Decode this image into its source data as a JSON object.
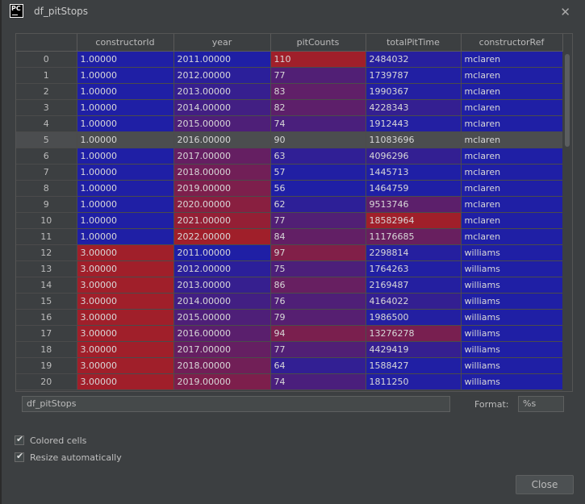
{
  "window": {
    "title": "df_pitStops"
  },
  "table": {
    "columns": [
      "constructorId",
      "year",
      "pitCounts",
      "totalPitTime",
      "constructorRef"
    ],
    "selected_row": "5",
    "rows": [
      {
        "index": "0",
        "constructorId": "1.00000",
        "year": "2011.00000",
        "pitCounts": "110",
        "totalPitTime": "2484032",
        "constructorRef": "mclaren"
      },
      {
        "index": "1",
        "constructorId": "1.00000",
        "year": "2012.00000",
        "pitCounts": "77",
        "totalPitTime": "1739787",
        "constructorRef": "mclaren"
      },
      {
        "index": "2",
        "constructorId": "1.00000",
        "year": "2013.00000",
        "pitCounts": "83",
        "totalPitTime": "1990367",
        "constructorRef": "mclaren"
      },
      {
        "index": "3",
        "constructorId": "1.00000",
        "year": "2014.00000",
        "pitCounts": "82",
        "totalPitTime": "4228343",
        "constructorRef": "mclaren"
      },
      {
        "index": "4",
        "constructorId": "1.00000",
        "year": "2015.00000",
        "pitCounts": "74",
        "totalPitTime": "1912443",
        "constructorRef": "mclaren"
      },
      {
        "index": "5",
        "constructorId": "1.00000",
        "year": "2016.00000",
        "pitCounts": "90",
        "totalPitTime": "11083696",
        "constructorRef": "mclaren"
      },
      {
        "index": "6",
        "constructorId": "1.00000",
        "year": "2017.00000",
        "pitCounts": "63",
        "totalPitTime": "4096296",
        "constructorRef": "mclaren"
      },
      {
        "index": "7",
        "constructorId": "1.00000",
        "year": "2018.00000",
        "pitCounts": "57",
        "totalPitTime": "1445713",
        "constructorRef": "mclaren"
      },
      {
        "index": "8",
        "constructorId": "1.00000",
        "year": "2019.00000",
        "pitCounts": "56",
        "totalPitTime": "1464759",
        "constructorRef": "mclaren"
      },
      {
        "index": "9",
        "constructorId": "1.00000",
        "year": "2020.00000",
        "pitCounts": "62",
        "totalPitTime": "9513746",
        "constructorRef": "mclaren"
      },
      {
        "index": "10",
        "constructorId": "1.00000",
        "year": "2021.00000",
        "pitCounts": "77",
        "totalPitTime": "18582964",
        "constructorRef": "mclaren"
      },
      {
        "index": "11",
        "constructorId": "1.00000",
        "year": "2022.00000",
        "pitCounts": "84",
        "totalPitTime": "11176685",
        "constructorRef": "mclaren"
      },
      {
        "index": "12",
        "constructorId": "3.00000",
        "year": "2011.00000",
        "pitCounts": "97",
        "totalPitTime": "2298814",
        "constructorRef": "williams"
      },
      {
        "index": "13",
        "constructorId": "3.00000",
        "year": "2012.00000",
        "pitCounts": "75",
        "totalPitTime": "1764263",
        "constructorRef": "williams"
      },
      {
        "index": "14",
        "constructorId": "3.00000",
        "year": "2013.00000",
        "pitCounts": "86",
        "totalPitTime": "2169487",
        "constructorRef": "williams"
      },
      {
        "index": "15",
        "constructorId": "3.00000",
        "year": "2014.00000",
        "pitCounts": "76",
        "totalPitTime": "4164022",
        "constructorRef": "williams"
      },
      {
        "index": "16",
        "constructorId": "3.00000",
        "year": "2015.00000",
        "pitCounts": "79",
        "totalPitTime": "1986500",
        "constructorRef": "williams"
      },
      {
        "index": "17",
        "constructorId": "3.00000",
        "year": "2016.00000",
        "pitCounts": "94",
        "totalPitTime": "13276278",
        "constructorRef": "williams"
      },
      {
        "index": "18",
        "constructorId": "3.00000",
        "year": "2017.00000",
        "pitCounts": "77",
        "totalPitTime": "4429419",
        "constructorRef": "williams"
      },
      {
        "index": "19",
        "constructorId": "3.00000",
        "year": "2018.00000",
        "pitCounts": "64",
        "totalPitTime": "1588427",
        "constructorRef": "williams"
      },
      {
        "index": "20",
        "constructorId": "3.00000",
        "year": "2019.00000",
        "pitCounts": "74",
        "totalPitTime": "1811250",
        "constructorRef": "williams"
      }
    ]
  },
  "name_field": {
    "value": "df_pitStops"
  },
  "format": {
    "label": "Format:",
    "value": "%s"
  },
  "options": {
    "colored_cells": {
      "label": "Colored cells",
      "checked": true
    },
    "resize_automatically": {
      "label": "Resize automatically",
      "checked": true
    }
  },
  "close_button": {
    "label": "Close"
  },
  "colors": {
    "low": "#1f1fa5",
    "high": "#a01f2a",
    "background": "#3c3f41",
    "selected": "#4b4d4f"
  },
  "icons": {
    "app": "pycharm-logo-icon",
    "close": "close-icon",
    "check": "check-icon"
  }
}
